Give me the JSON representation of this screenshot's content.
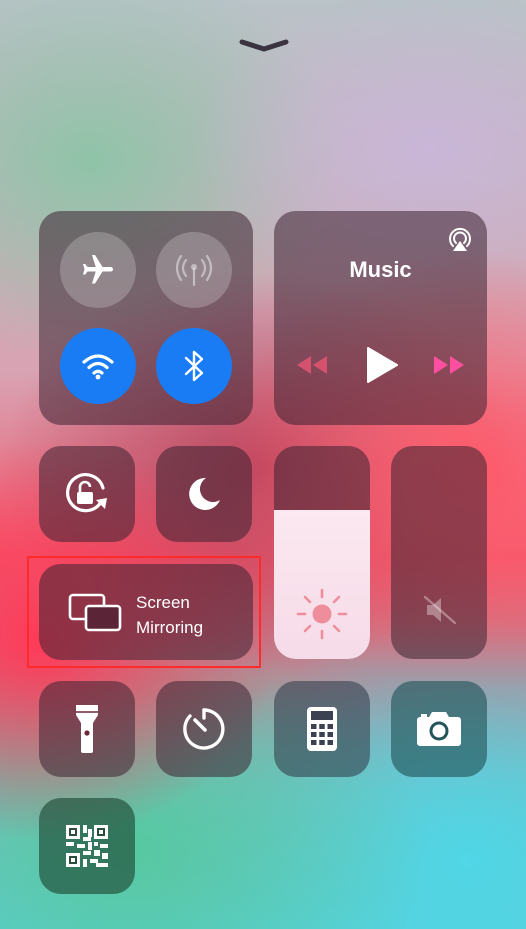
{
  "control_center": {
    "music": {
      "title": "Music"
    },
    "screen_mirroring": {
      "line1": "Screen",
      "line2": "Mirroring"
    },
    "brightness_level": 0.7,
    "volume_level": 0.0,
    "connectivity": {
      "airplane_mode": false,
      "cellular_data": false,
      "wifi": true,
      "bluetooth": true
    },
    "accent_color": "#1a7cf5",
    "highlight_color": "#ff2a2a"
  }
}
